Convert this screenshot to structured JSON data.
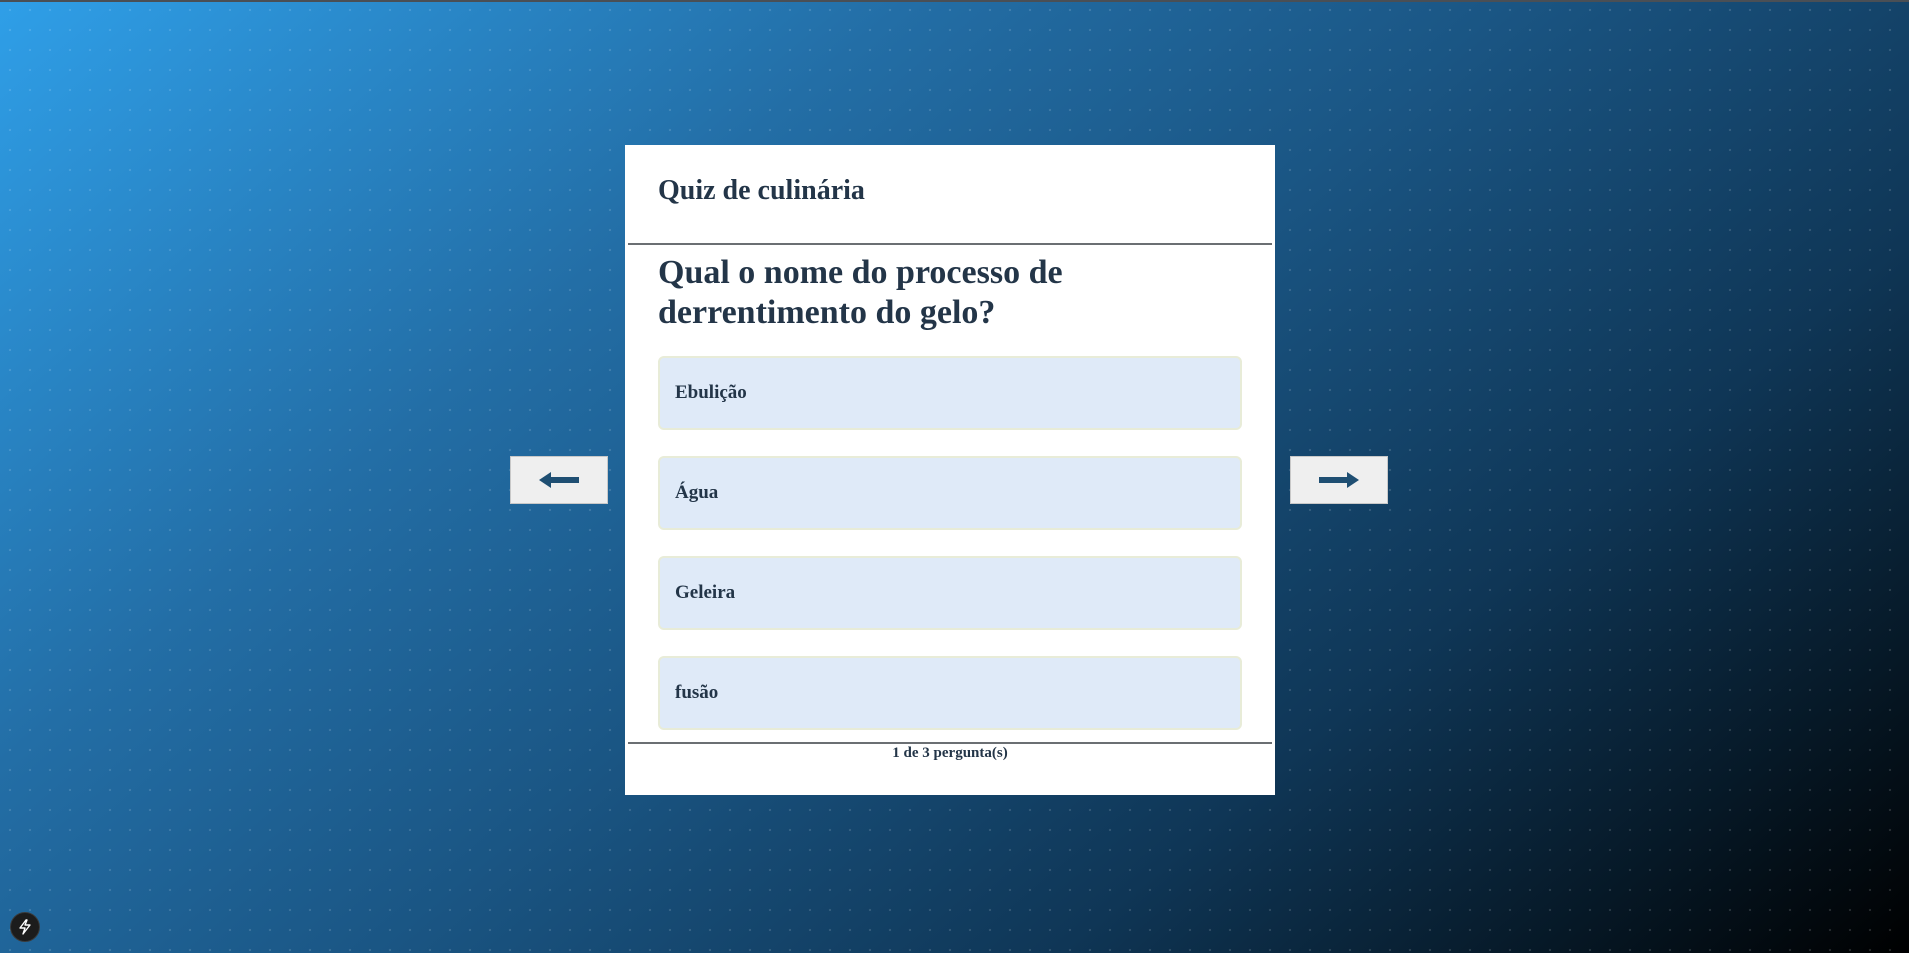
{
  "quiz": {
    "title": "Quiz de culinária",
    "question": "Qual o nome do processo de derrentimento do gelo?",
    "options": [
      {
        "label": "Ebulição"
      },
      {
        "label": "Água"
      },
      {
        "label": "Geleira"
      },
      {
        "label": "fusão"
      }
    ],
    "progress": "1 de 3 pergunta(s)"
  },
  "navigation": {
    "prev_icon": "arrow-left-icon",
    "next_icon": "arrow-right-icon"
  },
  "badge": {
    "icon": "lightning-bolt-icon"
  },
  "colors": {
    "text": "#233548",
    "option_background": "#dfeaf8",
    "arrow": "#1f4f73",
    "card": "#ffffff"
  }
}
